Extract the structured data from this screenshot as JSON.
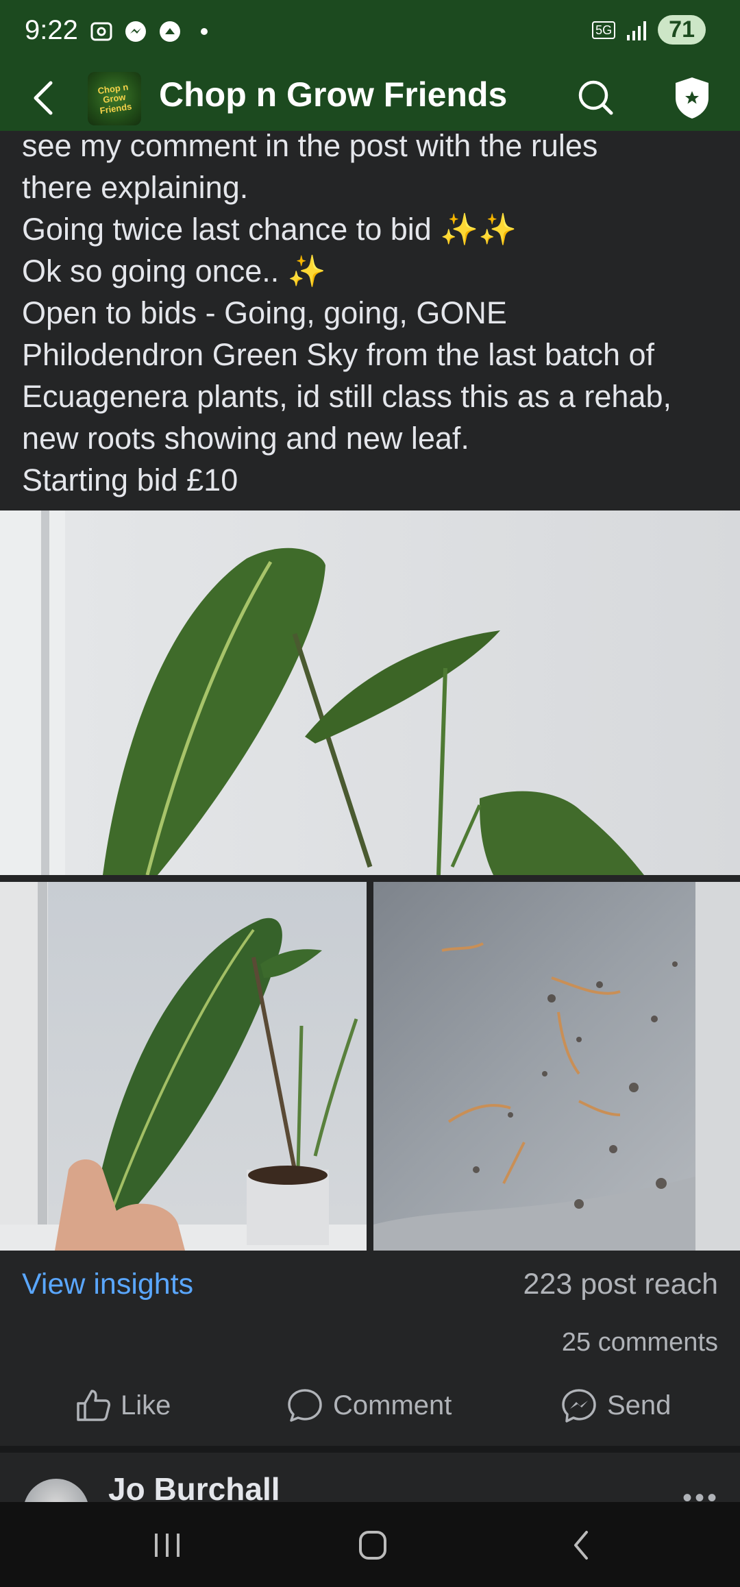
{
  "status_bar": {
    "time": "9:22",
    "network": "5G",
    "battery": "71"
  },
  "app_bar": {
    "group_name": "Chop n Grow Friends",
    "logo_text": "Chop n Grow Friends"
  },
  "post": {
    "lines": [
      "see my comment in the post with the rules",
      "there explaining.",
      "Going twice last chance to bid ✨✨",
      "Ok so going once..  ✨",
      "Open to bids - Going, going, GONE",
      "Philodendron Green Sky from the last batch of",
      "Ecuagenera plants, id still class this as a rehab,",
      "new roots showing and new leaf.",
      "Starting bid £10"
    ]
  },
  "stats": {
    "view_insights": "View insights",
    "reach": "223 post reach",
    "comments": "25 comments"
  },
  "actions": {
    "like": "Like",
    "comment": "Comment",
    "send": "Send"
  },
  "next_post": {
    "author": "Jo Burchall"
  },
  "icons": {
    "back": "back-arrow-icon",
    "search": "search-icon",
    "admin": "admin-shield-icon",
    "like": "thumbs-up-icon",
    "comment": "comment-bubble-icon",
    "send": "messenger-icon",
    "more": "more-dots-icon"
  },
  "colors": {
    "header_green": "#1c4a1f",
    "link_blue": "#5aa7ff",
    "background": "#242526"
  }
}
